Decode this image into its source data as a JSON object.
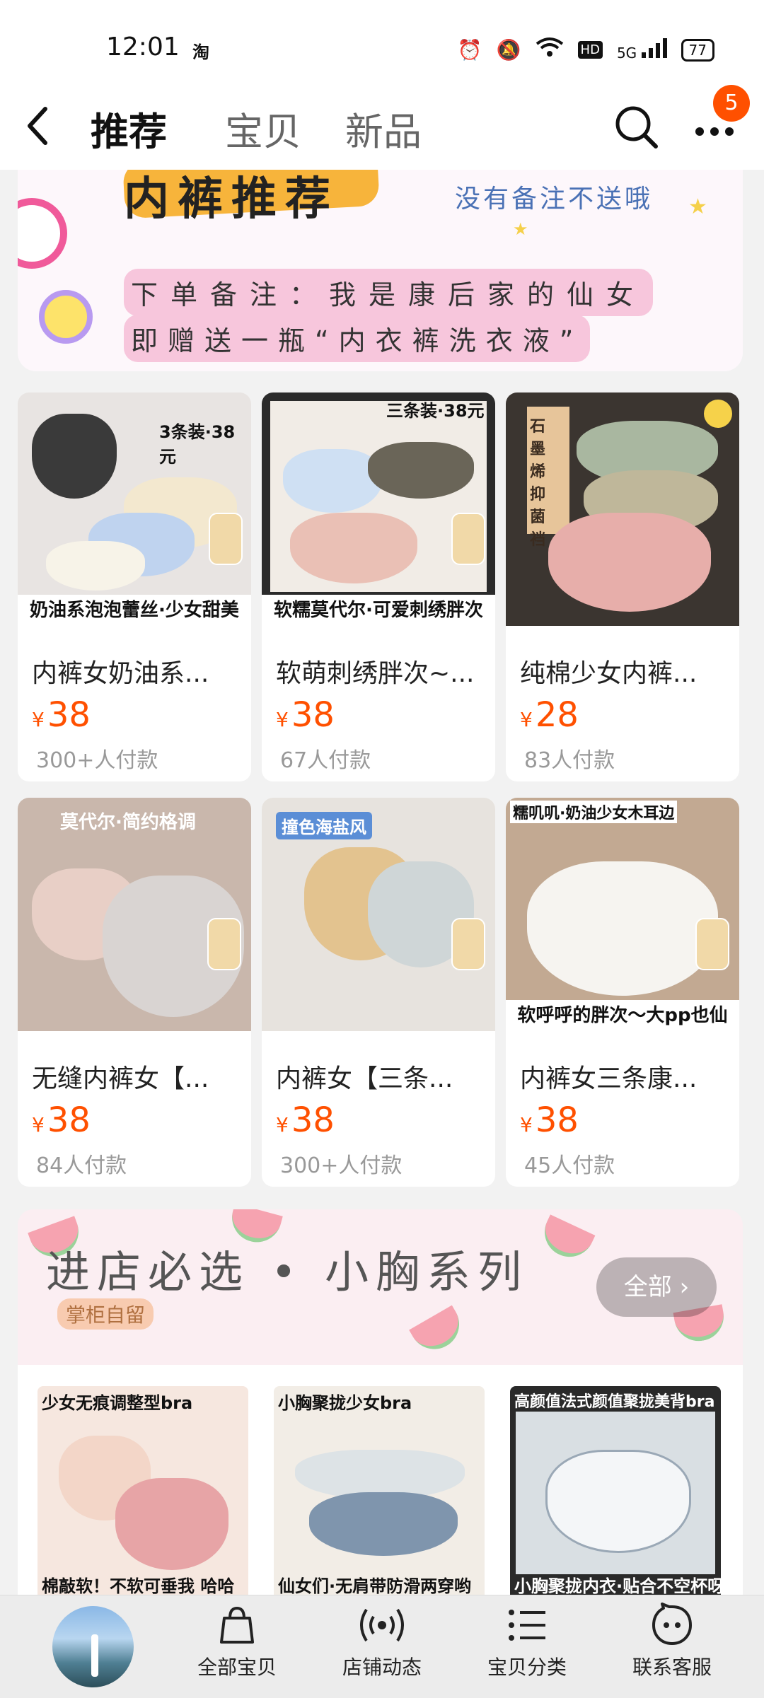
{
  "status": {
    "time": "12:01",
    "app": "淘",
    "battery": "77",
    "network": "5G"
  },
  "nav": {
    "tabs": [
      {
        "label": "推荐",
        "active": true
      },
      {
        "label": "宝贝",
        "active": false
      },
      {
        "label": "新品",
        "active": false
      }
    ],
    "badge": "5"
  },
  "banner": {
    "heading": "内裤推荐",
    "note_right": "没有备注不送哦",
    "note_line1": "下单备注：我是康后家的仙女",
    "note_line2": "即赠送一瓶“内衣裤洗衣液”"
  },
  "products": [
    {
      "title": "内裤女奶油系...",
      "price": "38",
      "sold": "300+人付款",
      "tag": "3条装·38元",
      "caption": "奶油系泡泡蕾丝·少女甜美"
    },
    {
      "title": "软萌刺绣胖次~...",
      "price": "38",
      "sold": "67人付款",
      "tag": "三条装·38元",
      "caption": "软糯莫代尔·可爱刺绣胖次"
    },
    {
      "title": "纯棉少女内裤...",
      "price": "28",
      "sold": "83人付款",
      "tag": "石墨烯抑菌裆",
      "caption": ""
    },
    {
      "title": "无缝内裤女【...",
      "price": "38",
      "sold": "84人付款",
      "tag": "莫代尔·简约格调",
      "caption": ""
    },
    {
      "title": "内裤女【三条...",
      "price": "38",
      "sold": "300+人付款",
      "tag": "撞色海盐风",
      "caption": ""
    },
    {
      "title": "内裤女三条康...",
      "price": "38",
      "sold": "45人付款",
      "tag": "糯叽叽·奶油少女木耳边",
      "caption": "软呼呼的胖次～大pp也仙"
    }
  ],
  "currency": "¥",
  "section": {
    "title": "进店必选 • 小胸系列",
    "subtitle": "掌柜自留",
    "all_label": "全部 ›"
  },
  "bras": [
    {
      "top": "少女无痕调整型bra",
      "bottom": "棉敲软！不软可垂我 哈哈"
    },
    {
      "top": "小胸聚拢少女bra",
      "bottom": "仙女们·无肩带防滑两穿哟"
    },
    {
      "top": "高颜值法式颜值聚拢美背bra",
      "bottom": "小胸聚拢内衣·贴合不空杯呀"
    }
  ],
  "bottombar": {
    "items": [
      {
        "label": "全部宝贝",
        "icon": "bag-icon"
      },
      {
        "label": "店铺动态",
        "icon": "broadcast-icon"
      },
      {
        "label": "宝贝分类",
        "icon": "list-icon"
      },
      {
        "label": "联系客服",
        "icon": "chat-face-icon"
      }
    ]
  }
}
